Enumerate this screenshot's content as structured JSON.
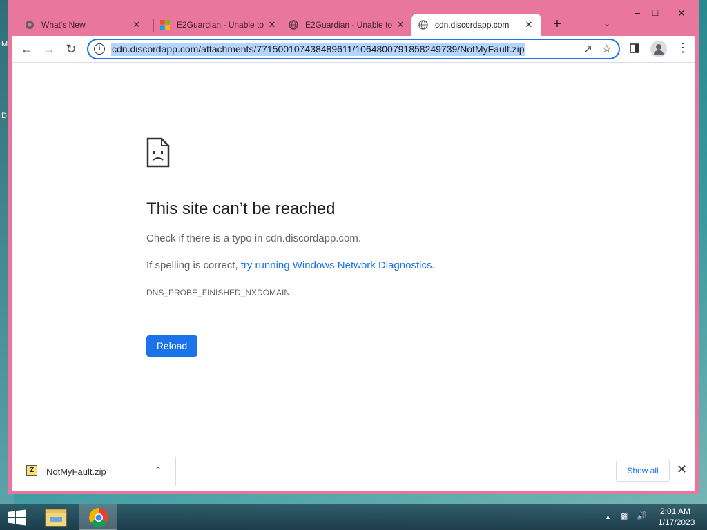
{
  "desktop": {
    "labels": [
      "M",
      "D"
    ]
  },
  "tabs": [
    {
      "title": "What's New",
      "icon": "chrome-settings-icon"
    },
    {
      "title": "E2Guardian - Unable to",
      "icon": "windows-logo-icon"
    },
    {
      "title": "E2Guardian - Unable to",
      "icon": "globe-icon"
    },
    {
      "title": "cdn.discordapp.com",
      "icon": "globe-icon"
    }
  ],
  "tab_close_glyph": "✕",
  "new_tab_glyph": "+",
  "omnibox": {
    "url": "cdn.discordapp.com/attachments/771500107438489611/1064800791858249739/NotMyFault.zip"
  },
  "error_page": {
    "heading": "This site can’t be reached",
    "line1": "Check if there is a typo in cdn.discordapp.com.",
    "line2_prefix": "If spelling is correct, ",
    "line2_link": "try running Windows Network Diagnostics",
    "line2_suffix": ".",
    "error_code": "DNS_PROBE_FINISHED_NXDOMAIN",
    "reload_label": "Reload"
  },
  "downloads": {
    "file_name": "NotMyFault.zip",
    "show_all_label": "Show all"
  },
  "taskbar": {
    "time": "2:01 AM",
    "date": "1/17/2023"
  },
  "colors": {
    "window_frame": "#e9769c",
    "accent": "#1a73e8",
    "url_highlight": "#b4d5fe"
  }
}
